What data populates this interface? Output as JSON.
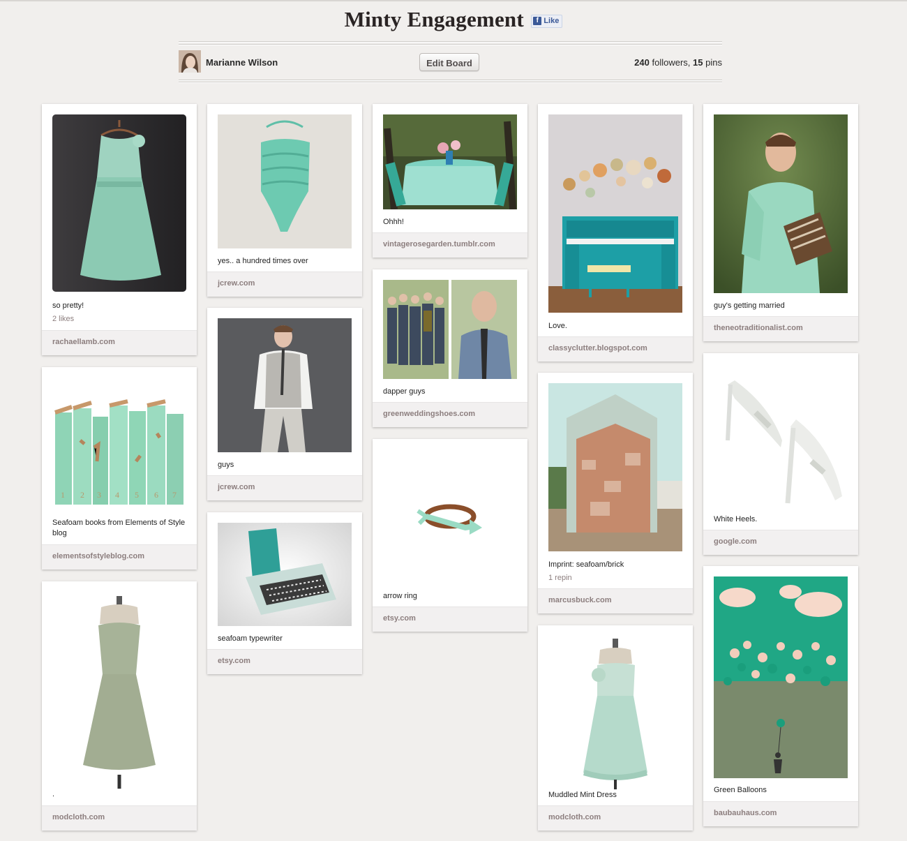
{
  "board": {
    "title": "Minty Engagement",
    "fb_like_label": "Like",
    "owner": "Marianne Wilson",
    "edit_label": "Edit Board",
    "followers": "240",
    "followers_label": "followers,",
    "pins": "15",
    "pins_label": "pins"
  },
  "pins": [
    {
      "desc": "so pretty!",
      "likes": "2 likes",
      "source": "rachaellamb.com",
      "image": "mint-chiffon-dress-on-hanger"
    },
    {
      "desc": "Seafoam books from Elements of Style blog",
      "source": "elementsofstyleblog.com",
      "image": "seafoam-books"
    },
    {
      "desc": ".",
      "source": "modcloth.com",
      "image": "sage-strapless-dress-on-form"
    },
    {
      "desc": "yes.. a hundred times over",
      "source": "jcrew.com",
      "image": "mint-ruched-swimsuit"
    },
    {
      "desc": "guys",
      "source": "jcrew.com",
      "image": "man-in-grey-vest"
    },
    {
      "desc": "seafoam typewriter",
      "source": "etsy.com",
      "image": "seafoam-typewriter"
    },
    {
      "desc": "Ohhh!",
      "source": "vintagerosegarden.tumblr.com",
      "image": "mint-table-setting"
    },
    {
      "desc": "dapper guys",
      "source": "greenweddingshoes.com",
      "image": "groomsmen-collage"
    },
    {
      "desc": "arrow ring",
      "source": "etsy.com",
      "image": "arrow-ring"
    },
    {
      "desc": "Love.",
      "source": "classyclutter.blogspot.com",
      "image": "turquoise-piano"
    },
    {
      "desc": "Imprint: seafoam/brick",
      "likes": "1 repin",
      "source": "marcusbuck.com",
      "image": "seafoam-brick-house"
    },
    {
      "desc": "Muddled Mint Dress",
      "source": "modcloth.com",
      "image": "mint-babydoll-dress-on-form"
    },
    {
      "desc": "guy's getting married",
      "source": "theneotraditionalist.com",
      "image": "man-holding-book"
    },
    {
      "desc": "White Heels.",
      "source": "google.com",
      "image": "white-heels"
    },
    {
      "desc": "Green Balloons",
      "source": "baubauhaus.com",
      "image": "green-balloons-illustration"
    }
  ]
}
